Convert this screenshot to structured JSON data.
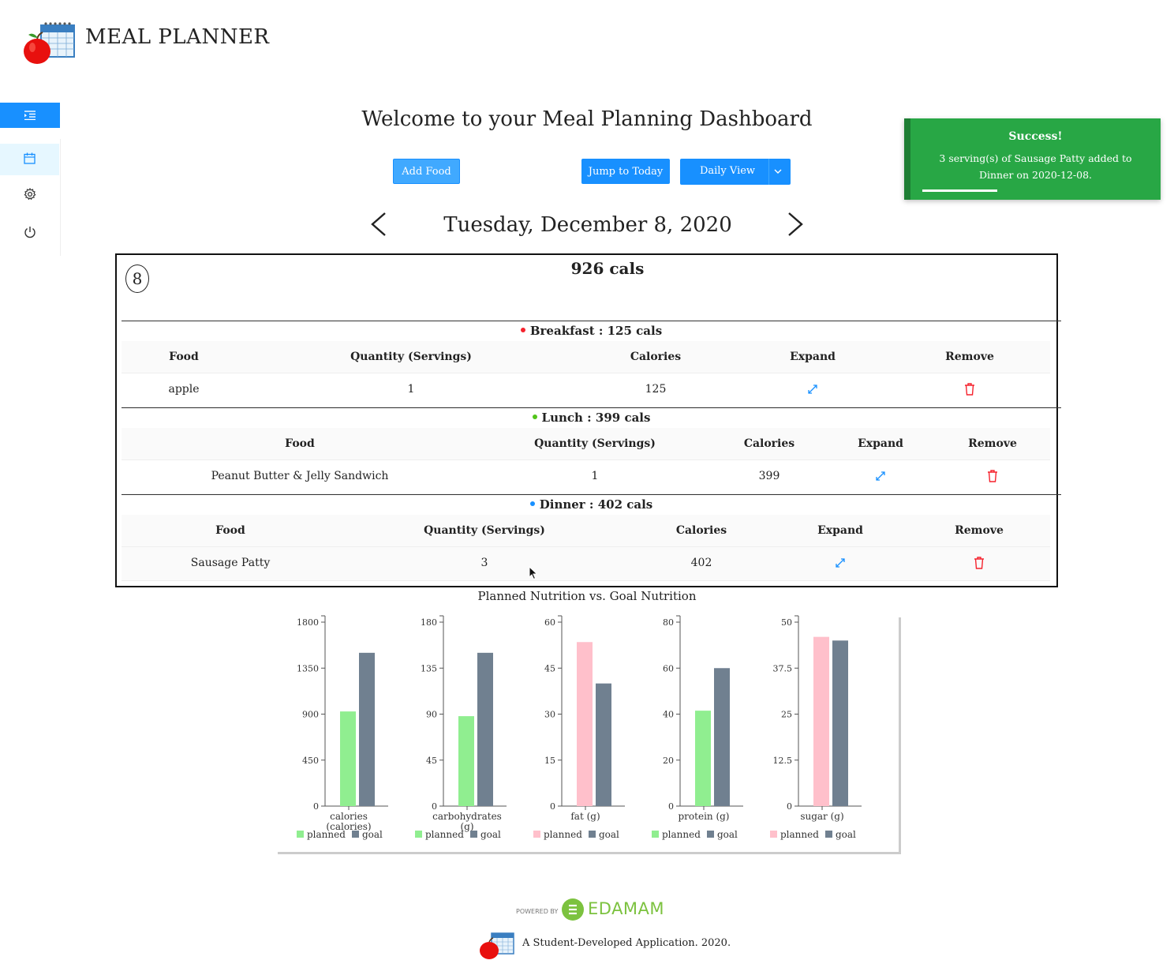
{
  "header": {
    "app_title": "MEAL PLANNER"
  },
  "sidebar": {
    "items": [
      {
        "icon": "menu-indent-icon"
      },
      {
        "icon": "calendar-icon"
      },
      {
        "icon": "gear-icon"
      },
      {
        "icon": "power-icon"
      }
    ]
  },
  "main": {
    "welcome": "Welcome to your Meal Planning Dashboard",
    "add_food_label": "Add Food",
    "jump_today_label": "Jump to Today",
    "view_select": "Daily View",
    "date": "Tuesday, December 8, 2020"
  },
  "toast": {
    "title": "Success!",
    "message": "3 serving(s) of Sausage Patty added to Dinner on 2020-12-08.",
    "progress": 0.32,
    "color": "#28a745"
  },
  "day": {
    "number": "8",
    "total": "926 cals",
    "columns": [
      "Food",
      "Quantity (Servings)",
      "Calories",
      "Expand",
      "Remove"
    ],
    "meals": [
      {
        "heading": "Breakfast : 125 cals",
        "dot_color": "#f5222d",
        "rows": [
          {
            "food": "apple",
            "qty": "1",
            "cal": "125"
          }
        ]
      },
      {
        "heading": "Lunch : 399 cals",
        "dot_color": "#52c41a",
        "rows": [
          {
            "food": "Peanut Butter & Jelly Sandwich",
            "qty": "1",
            "cal": "399"
          }
        ]
      },
      {
        "heading": "Dinner : 402 cals",
        "dot_color": "#1890ff",
        "rows": [
          {
            "food": "Sausage Patty",
            "qty": "3",
            "cal": "402"
          }
        ]
      }
    ]
  },
  "chart_data": {
    "type": "bar",
    "title": "Planned Nutrition vs. Goal Nutrition",
    "legend": [
      "planned",
      "goal"
    ],
    "panels": [
      {
        "label": "calories (calories)",
        "label_lines": [
          "calories",
          "(calories)"
        ],
        "ticks": [
          "0",
          "450",
          "900",
          "1350",
          "1800"
        ],
        "max": 1800,
        "planned": 926,
        "goal": 1500,
        "planned_color": "#90ee90",
        "goal_color": "#708090"
      },
      {
        "label": "carbohydrates (g)",
        "label_lines": [
          "carbohydrates",
          "(g)"
        ],
        "ticks": [
          "0",
          "45",
          "90",
          "135",
          "180"
        ],
        "max": 180,
        "planned": 88,
        "goal": 150,
        "planned_color": "#90ee90",
        "goal_color": "#708090"
      },
      {
        "label": "fat (g)",
        "label_lines": [
          "fat (g)"
        ],
        "ticks": [
          "0",
          "15",
          "30",
          "45",
          "60"
        ],
        "max": 60,
        "planned": 53.5,
        "goal": 40,
        "planned_color": "#ffc0cb",
        "goal_color": "#708090"
      },
      {
        "label": "protein (g)",
        "label_lines": [
          "protein (g)"
        ],
        "ticks": [
          "0",
          "20",
          "40",
          "60",
          "80"
        ],
        "max": 80,
        "planned": 41.5,
        "goal": 60,
        "planned_color": "#90ee90",
        "goal_color": "#708090"
      },
      {
        "label": "sugar (g)",
        "label_lines": [
          "sugar (g)"
        ],
        "ticks": [
          "0",
          "12.5",
          "25",
          "37.5",
          "50"
        ],
        "max": 50,
        "planned": 46,
        "goal": 45,
        "planned_color": "#ffc0cb",
        "goal_color": "#708090"
      }
    ]
  },
  "footer": {
    "powered_by": "POWERED BY",
    "edamam": "EDAMAM",
    "credit": "A Student-Developed Application. 2020."
  }
}
